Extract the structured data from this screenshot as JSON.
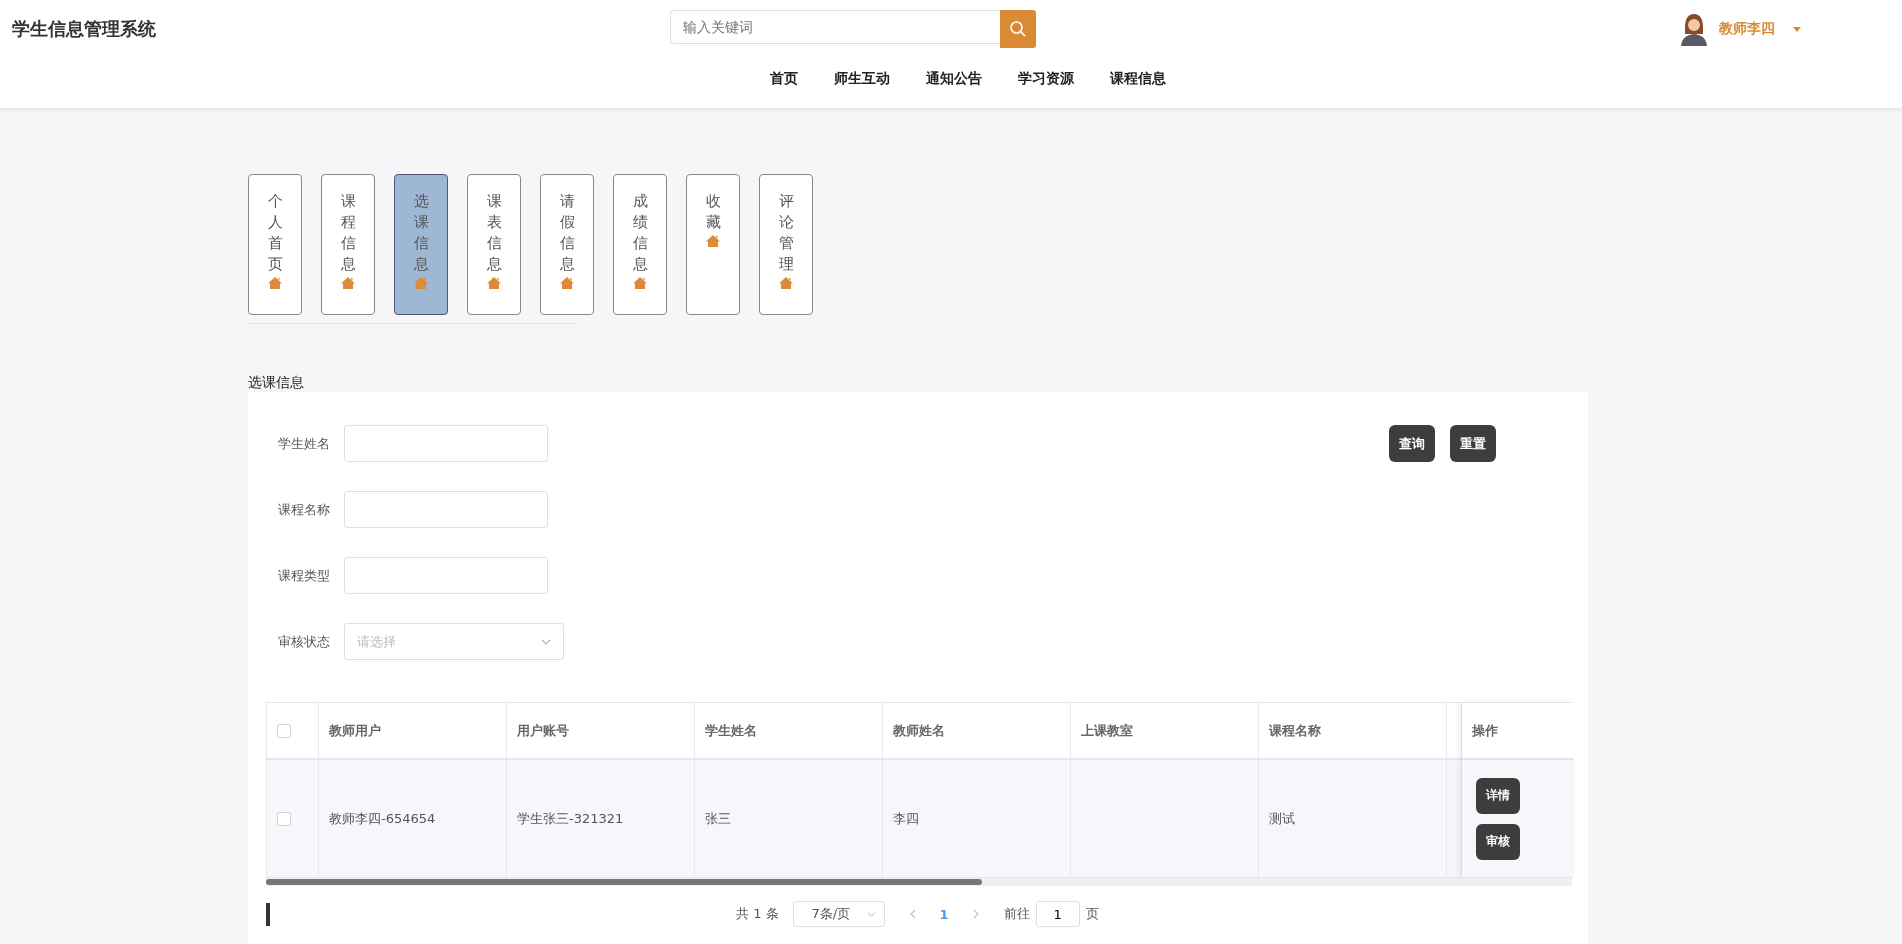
{
  "header": {
    "title": "学生信息管理系统",
    "search": {
      "placeholder": "输入关键词"
    },
    "user": {
      "name": "教师李四"
    }
  },
  "nav": [
    "首页",
    "师生互动",
    "通知公告",
    "学习资源",
    "课程信息"
  ],
  "tabs": [
    {
      "label": "个人首页",
      "selected": false
    },
    {
      "label": "课程信息",
      "selected": false
    },
    {
      "label": "选课信息",
      "selected": true
    },
    {
      "label": "课表信息",
      "selected": false
    },
    {
      "label": "请假信息",
      "selected": false
    },
    {
      "label": "成绩信息",
      "selected": false
    },
    {
      "label": "收藏",
      "selected": false
    },
    {
      "label": "评论管理",
      "selected": false
    }
  ],
  "section_title": "选课信息",
  "filters": [
    {
      "kind": "input",
      "label": "学生姓名"
    },
    {
      "kind": "input",
      "label": "课程名称"
    },
    {
      "kind": "input",
      "label": "课程类型"
    },
    {
      "kind": "select",
      "label": "审核状态",
      "placeholder": "请选择"
    }
  ],
  "buttons": [
    "查询",
    "重置"
  ],
  "table": {
    "all_checked": false,
    "columns": [
      "教师用户",
      "用户账号",
      "学生姓名",
      "教师姓名",
      "上课教室",
      "课程名称"
    ],
    "action_column": "操作",
    "rows": [
      {
        "checked": false,
        "cells": [
          "教师李四-654654",
          "学生张三-321321",
          "张三",
          "李四",
          null,
          "测试"
        ],
        "actions": [
          "详情",
          "审核"
        ]
      }
    ]
  },
  "pagination": {
    "total": "共 1 条",
    "page_size": "7条/页",
    "pages": [
      {
        "label": "1",
        "selected": true
      }
    ],
    "goto_label": "前往",
    "goto_value": "1",
    "goto_unit": "页"
  }
}
